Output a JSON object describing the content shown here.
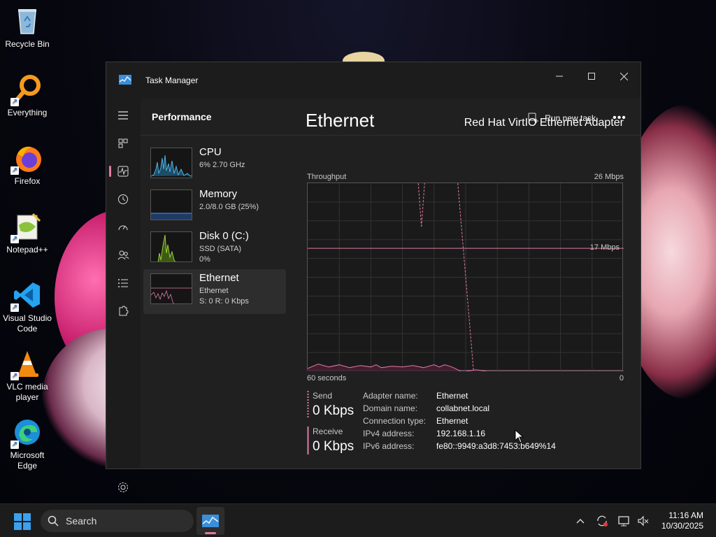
{
  "desktop": {
    "icons": [
      {
        "label": "Recycle Bin"
      },
      {
        "label": "Everything"
      },
      {
        "label": "Firefox"
      },
      {
        "label": "Notepad++"
      },
      {
        "label": "Visual Studio Code"
      },
      {
        "label": "VLC media player"
      },
      {
        "label": "Microsoft Edge"
      }
    ]
  },
  "window": {
    "title": "Task Manager",
    "page_title": "Performance",
    "run_new_task": "Run new task",
    "more": "•••"
  },
  "devices": [
    {
      "name": "CPU",
      "line1": "6%  2.70 GHz",
      "line2": ""
    },
    {
      "name": "Memory",
      "line1": "2.0/8.0 GB (25%)",
      "line2": ""
    },
    {
      "name": "Disk 0 (C:)",
      "line1": "SSD (SATA)",
      "line2": "0%"
    },
    {
      "name": "Ethernet",
      "line1": "Ethernet",
      "line2": "S: 0  R: 0 Kbps"
    }
  ],
  "detail": {
    "title": "Ethernet",
    "adapter": "Red Hat VirtIO Ethernet Adapter",
    "throughput_label": "Throughput",
    "max_label": "26 Mbps",
    "mid_label": "17 Mbps",
    "time_left": "60 seconds",
    "time_right": "0",
    "send_label": "Send",
    "send_value": "0 Kbps",
    "receive_label": "Receive",
    "receive_value": "0 Kbps",
    "stats": [
      {
        "key": "Adapter name:",
        "value": "Ethernet"
      },
      {
        "key": "Domain name:",
        "value": "collabnet.local"
      },
      {
        "key": "Connection type:",
        "value": "Ethernet"
      },
      {
        "key": "IPv4 address:",
        "value": "192.168.1.16"
      },
      {
        "key": "IPv6 address:",
        "value": "fe80::9949:a3d8:7453:b649%14"
      }
    ]
  },
  "chart_data": {
    "type": "line",
    "title": "Throughput",
    "xlabel": "",
    "ylabel": "",
    "xlim": [
      60,
      0
    ],
    "ylim": [
      0,
      26
    ],
    "y_max_label": "26 Mbps",
    "reference_line": 17,
    "x": [
      60,
      58,
      56,
      54,
      52,
      50,
      48,
      47,
      46,
      44,
      42,
      40,
      38,
      36,
      35,
      34,
      33,
      32,
      31,
      30,
      28,
      26,
      24,
      22,
      20,
      18,
      16,
      14,
      12,
      10,
      8,
      6,
      4,
      2,
      0
    ],
    "series": [
      {
        "name": "Receive",
        "values": [
          0.4,
          1.0,
          0.6,
          0.9,
          0.5,
          0.8,
          0.6,
          0.9,
          0.5,
          0.7,
          0.6,
          0.8,
          0.5,
          0.9,
          0.6,
          0.9,
          0.7,
          0.4,
          0,
          0,
          0.2,
          0,
          0,
          0,
          0,
          0,
          0,
          0,
          0,
          0,
          0,
          0,
          0,
          0,
          0
        ]
      }
    ],
    "spikes": [
      {
        "x_from": 39.0,
        "x_to": 38.4,
        "y_peak": 26,
        "y_low": 20
      },
      {
        "x_from": 38.4,
        "x_to": 37.8,
        "y_peak": 20,
        "y_low": 26
      },
      {
        "x_from": 31.5,
        "x_to": 28.5,
        "y_peak": 26,
        "y_low": 0
      }
    ],
    "grid": true,
    "colors": {
      "line": "#e07aa6",
      "grid": "#333333",
      "fill": "#4a1f33"
    }
  },
  "taskbar": {
    "search_placeholder": "Search",
    "time": "11:16 AM",
    "date": "10/30/2025"
  }
}
